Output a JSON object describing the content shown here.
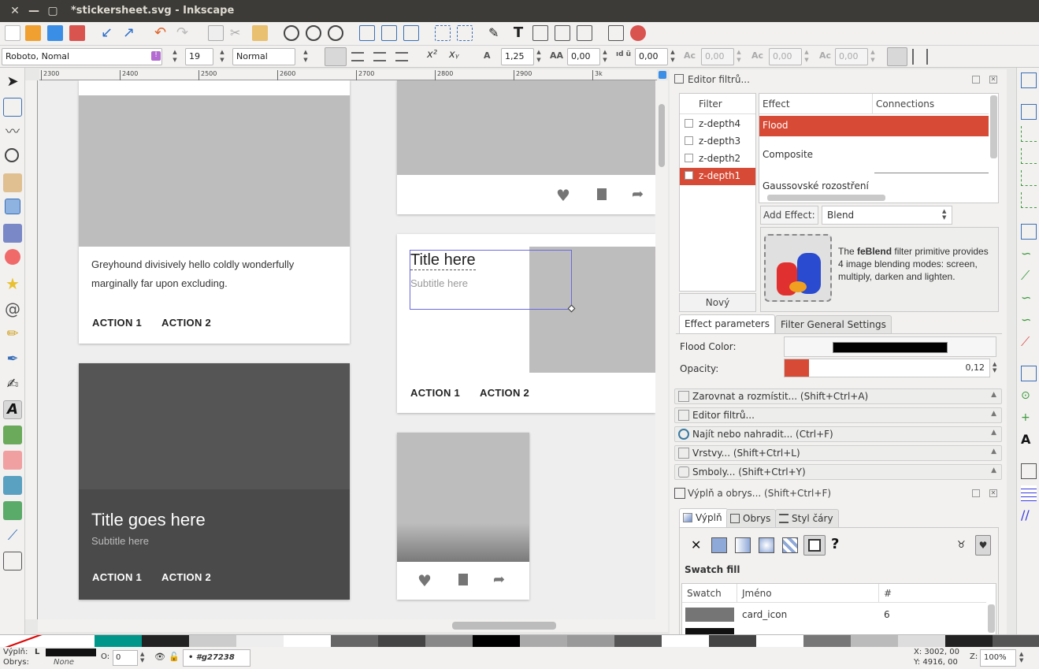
{
  "window": {
    "title": "*stickersheet.svg - Inkscape"
  },
  "toolctl": {
    "font_family": "Roboto, Nomal",
    "font_size": "19",
    "font_style": "Normal",
    "line_spacing": "1,25",
    "letter_spacing": "0,00",
    "word_spacing": "0,00",
    "kern_h": "0,00",
    "kern_v": "0,00",
    "rotation": "0,00"
  },
  "ruler": {
    "labels": [
      "2300",
      "2400",
      "2500",
      "2600",
      "2700",
      "2800",
      "2900",
      "3k"
    ]
  },
  "canvas": {
    "card1": {
      "body": "Greyhound divisively hello coldly wonderfully marginally far upon excluding.",
      "action1": "ACTION 1",
      "action2": "ACTION 2"
    },
    "card2": {
      "title": "Title goes here",
      "subtitle": "Subtitle here",
      "action1": "ACTION 1",
      "action2": "ACTION 2"
    },
    "card4": {
      "title": "Title here",
      "subtitle": "Subtitle here",
      "action1": "ACTION 1",
      "action2": "ACTION 2"
    }
  },
  "filter_editor": {
    "title": "Editor filtrů...",
    "filter_header": "Filter",
    "filters": [
      {
        "name": "z-depth4",
        "selected": false
      },
      {
        "name": "z-depth3",
        "selected": false
      },
      {
        "name": "z-depth2",
        "selected": false
      },
      {
        "name": "z-depth1",
        "selected": true
      }
    ],
    "new_button": "Nový",
    "effect_header": "Effect",
    "connections_header": "Connections",
    "effects": [
      "Flood",
      "Composite",
      "Gaussovské rozostření"
    ],
    "add_effect_label": "Add Effect:",
    "add_effect_value": "Blend",
    "desc_pre": "The ",
    "desc_bold": "feBlend",
    "desc_post": " filter primitive provides 4 image blending modes: screen, multiply, darken and lighten.",
    "tab_params": "Effect parameters",
    "tab_general": "Filter General Settings",
    "flood_color_label": "Flood Color:",
    "flood_color": "#000000",
    "opacity_label": "Opacity:",
    "opacity_value": "0,12",
    "opacity_fraction": 0.12
  },
  "docked_panels": [
    "Zarovnat a rozmístit... (Shift+Ctrl+A)",
    "Editor filtrů...",
    "Najít nebo nahradit... (Ctrl+F)",
    "Vrstvy... (Shift+Ctrl+L)",
    "Smboly... (Shift+Ctrl+Y)"
  ],
  "fill_stroke": {
    "title": "Výplň a obrys... (Shift+Ctrl+F)",
    "tab_fill": "Výplň",
    "tab_stroke": "Obrys",
    "tab_style": "Styl čáry",
    "fill_mode_label": "Swatch fill",
    "col_swatch": "Swatch",
    "col_name": "Jméno",
    "col_count": "#",
    "rows": [
      {
        "name": "card_icon",
        "count": "6",
        "color": "#757575"
      }
    ]
  },
  "status": {
    "fill_label": "Výplň:",
    "stroke_label": "Obrys:",
    "fill_value": "L",
    "stroke_value": "None",
    "opacity_label": "O:",
    "opacity_value": "0",
    "object_id": "• #g27238",
    "coords_x": "X: 3002, 00",
    "coords_y": "Y: 4916, 00",
    "zoom_label": "Z:",
    "zoom": "100%"
  },
  "colors": {
    "selection_red": "#d74a35",
    "accent_teal": "#00968a"
  }
}
